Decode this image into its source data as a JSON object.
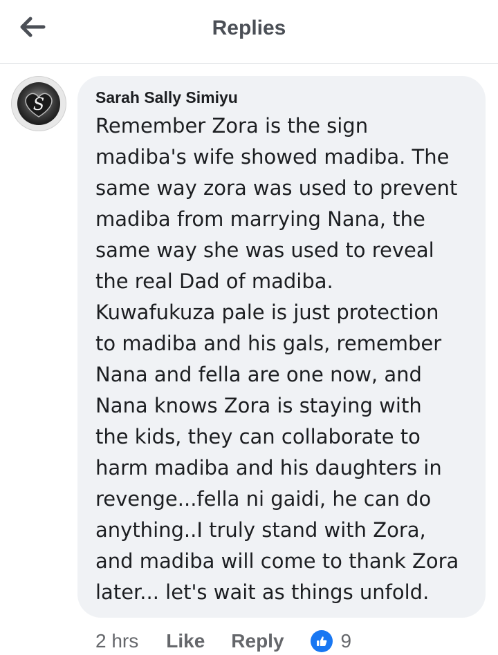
{
  "header": {
    "title": "Replies",
    "back_icon": "arrow-left-icon"
  },
  "reply": {
    "author": "Sarah Sally Simiyu",
    "avatar_icon": "profile-photo",
    "text": "Remember Zora is the sign\nmadiba's wife showed madiba. The\nsame way zora was used to prevent\nmadiba from marrying Nana, the\nsame way she was used to reveal\nthe real Dad of madiba.\nKuwafukuza pale is just protection\nto madiba and his gals, remember\nNana and fella are one now, and\nNana knows Zora is staying with\nthe kids, they can collaborate to\nharm madiba and his daughters in\nrevenge...fella ni gaidi, he can do\nanything..I truly stand with Zora,\nand madiba will come to thank Zora\nlater... let's wait as things unfold.",
    "timestamp": "2 hrs",
    "like_label": "Like",
    "reply_label": "Reply",
    "reaction_count": "9",
    "reaction_icon": "thumbs-up-icon"
  },
  "colors": {
    "bubble": "#f0f2f5",
    "accent": "#1877f2",
    "text": "#1c1e21",
    "muted": "#65676b"
  }
}
